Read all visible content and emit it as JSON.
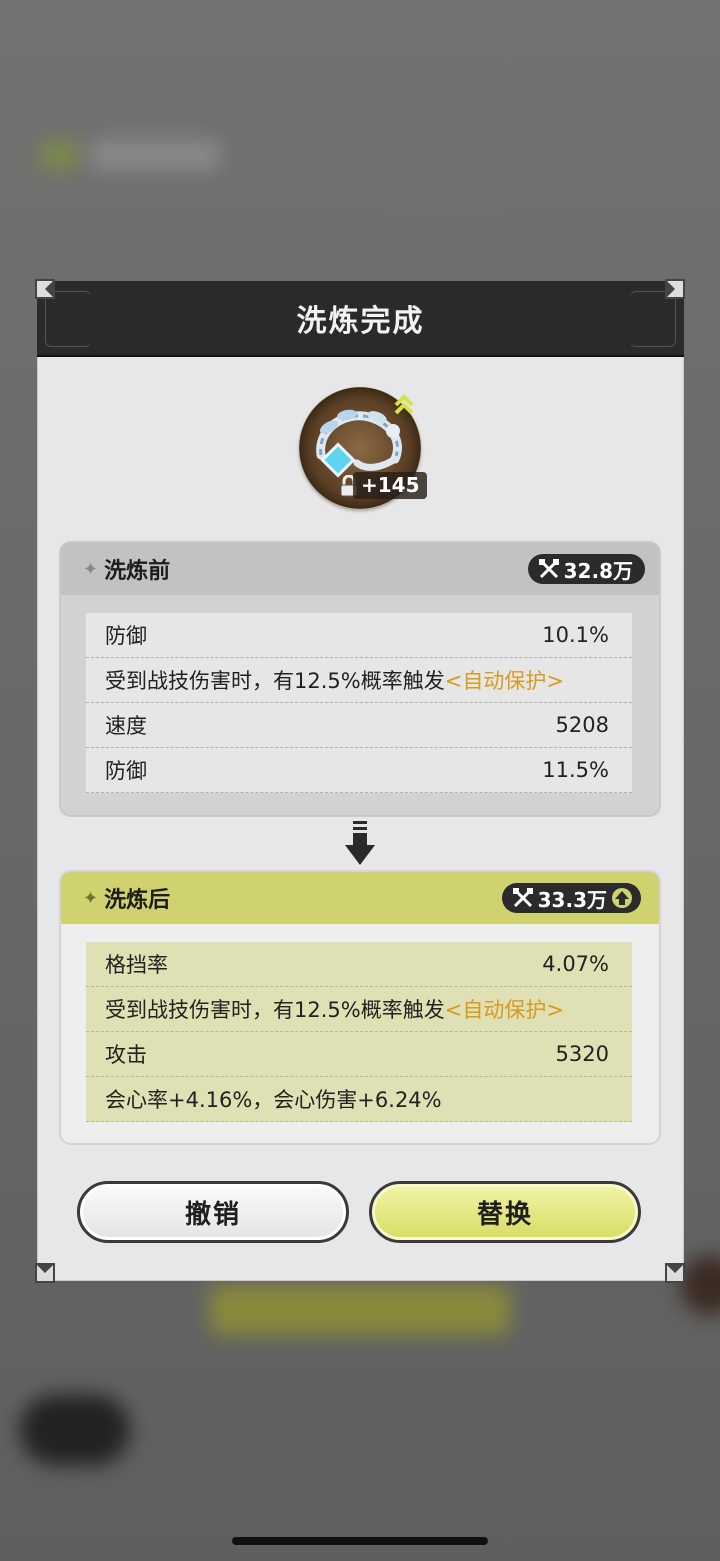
{
  "dialog": {
    "title": "洗炼完成"
  },
  "item": {
    "level": "+145",
    "name_icon": "bracelet-icon",
    "locked": true
  },
  "before": {
    "title": "洗炼前",
    "power": "32.8万",
    "rows": [
      {
        "label": "防御",
        "value": "10.1%"
      },
      {
        "label": "受到战技伤害时，有12.5%概率触发",
        "link": "<自动保护>"
      },
      {
        "label": "速度",
        "value": "5208"
      },
      {
        "label": "防御",
        "value": "11.5%"
      }
    ]
  },
  "after": {
    "title": "洗炼后",
    "power": "33.3万",
    "rows": [
      {
        "label": "格挡率",
        "value": "4.07%"
      },
      {
        "label": "受到战技伤害时，有12.5%概率触发",
        "link": "<自动保护>"
      },
      {
        "label": "攻击",
        "value": "5320"
      },
      {
        "label": "会心率+4.16%，会心伤害+6.24%"
      }
    ]
  },
  "buttons": {
    "cancel": "撤销",
    "confirm": "替换"
  },
  "colors": {
    "header_bg": "#2a2a2c",
    "after_accent": "#cfd26e",
    "link": "#d69b20",
    "confirm_button": "#d8dc63"
  }
}
